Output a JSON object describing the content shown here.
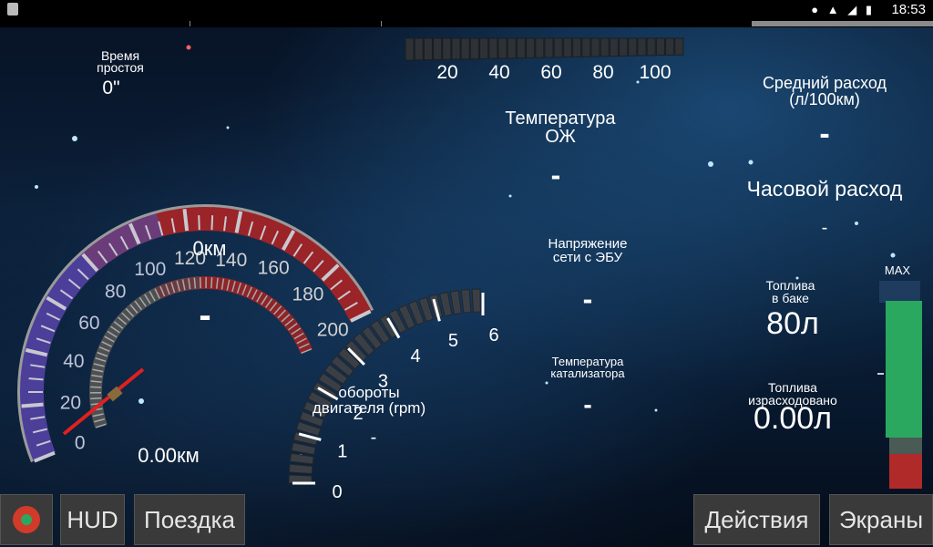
{
  "status_bar": {
    "time": "18:53",
    "icons": [
      "location-icon",
      "wifi-icon",
      "signal-icon",
      "battery-icon"
    ]
  },
  "idle": {
    "label_line1": "Время",
    "label_line2": "простоя",
    "value": "0\""
  },
  "speedometer": {
    "scale": [
      "0",
      "20",
      "40",
      "60",
      "80",
      "100",
      "120",
      "140",
      "160",
      "180",
      "200"
    ],
    "distance": "0км",
    "speed": "-",
    "trip_distance": "0.00км"
  },
  "tachometer": {
    "scale": [
      "0",
      "1",
      "2",
      "3",
      "4",
      "5",
      "6"
    ],
    "label_line1": "обороты",
    "label_line2": "двигателя (rpm)",
    "value": "-"
  },
  "top_scale": [
    "20",
    "40",
    "60",
    "80",
    "100"
  ],
  "coolant": {
    "label_line1": "Температура",
    "label_line2": "ОЖ",
    "value": "-"
  },
  "voltage": {
    "label_line1": "Напряжение",
    "label_line2": "сети с ЭБУ",
    "value": "-"
  },
  "catalyst": {
    "label_line1": "Температура",
    "label_line2": "катализатора",
    "value": "-"
  },
  "avg_consumption": {
    "label_line1": "Средний расход",
    "label_line2": "(л/100км)",
    "value": "-"
  },
  "hourly_consumption": {
    "label": "Часовой расход",
    "value": "-"
  },
  "fuel_tank": {
    "label_line1": "Топлива",
    "label_line2": "в баке",
    "value": "80л"
  },
  "fuel_used": {
    "label_line1": "Топлива",
    "label_line2": "израсходовано",
    "value": "0.00л"
  },
  "fuel_bar": {
    "label": "MAX",
    "level": 1.0
  },
  "buttons": {
    "hud": "HUD",
    "trip": "Поездка",
    "actions": "Действия",
    "screens": "Экраны"
  },
  "colors": {
    "accent_red": "#b3262b",
    "accent_purple": "#5a4aa0",
    "fuel_green": "#2aa860",
    "fuel_red": "#b02a2a"
  }
}
